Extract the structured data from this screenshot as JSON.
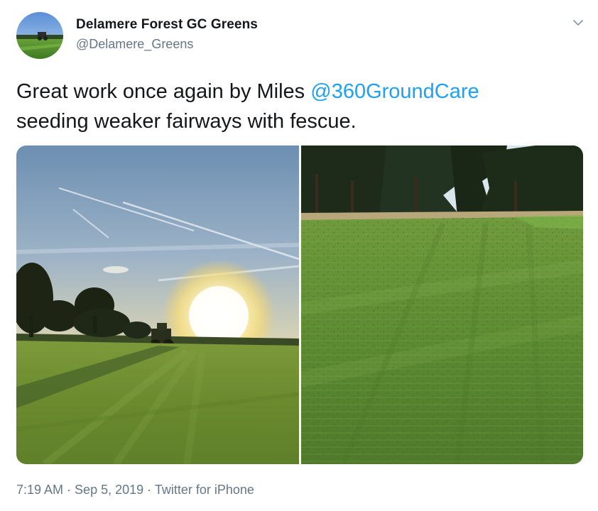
{
  "user": {
    "name": "Delamere Forest GC Greens",
    "handle": "@Delamere_Greens"
  },
  "tweet": {
    "text_before": "Great work once again by Miles ",
    "mention": "@360GroundCare",
    "text_after": "seeding weaker fairways with fescue."
  },
  "meta": {
    "time": "7:19 AM",
    "separator1": " · ",
    "date": "Sep 5, 2019",
    "separator2": " · ",
    "source": "Twitter for iPhone"
  },
  "icons": {
    "more": "chevron-down-icon",
    "avatar": "golf-course-avatar"
  },
  "colors": {
    "link": "#1da1f2",
    "secondary_text": "#657786",
    "primary_text": "#14171a"
  }
}
